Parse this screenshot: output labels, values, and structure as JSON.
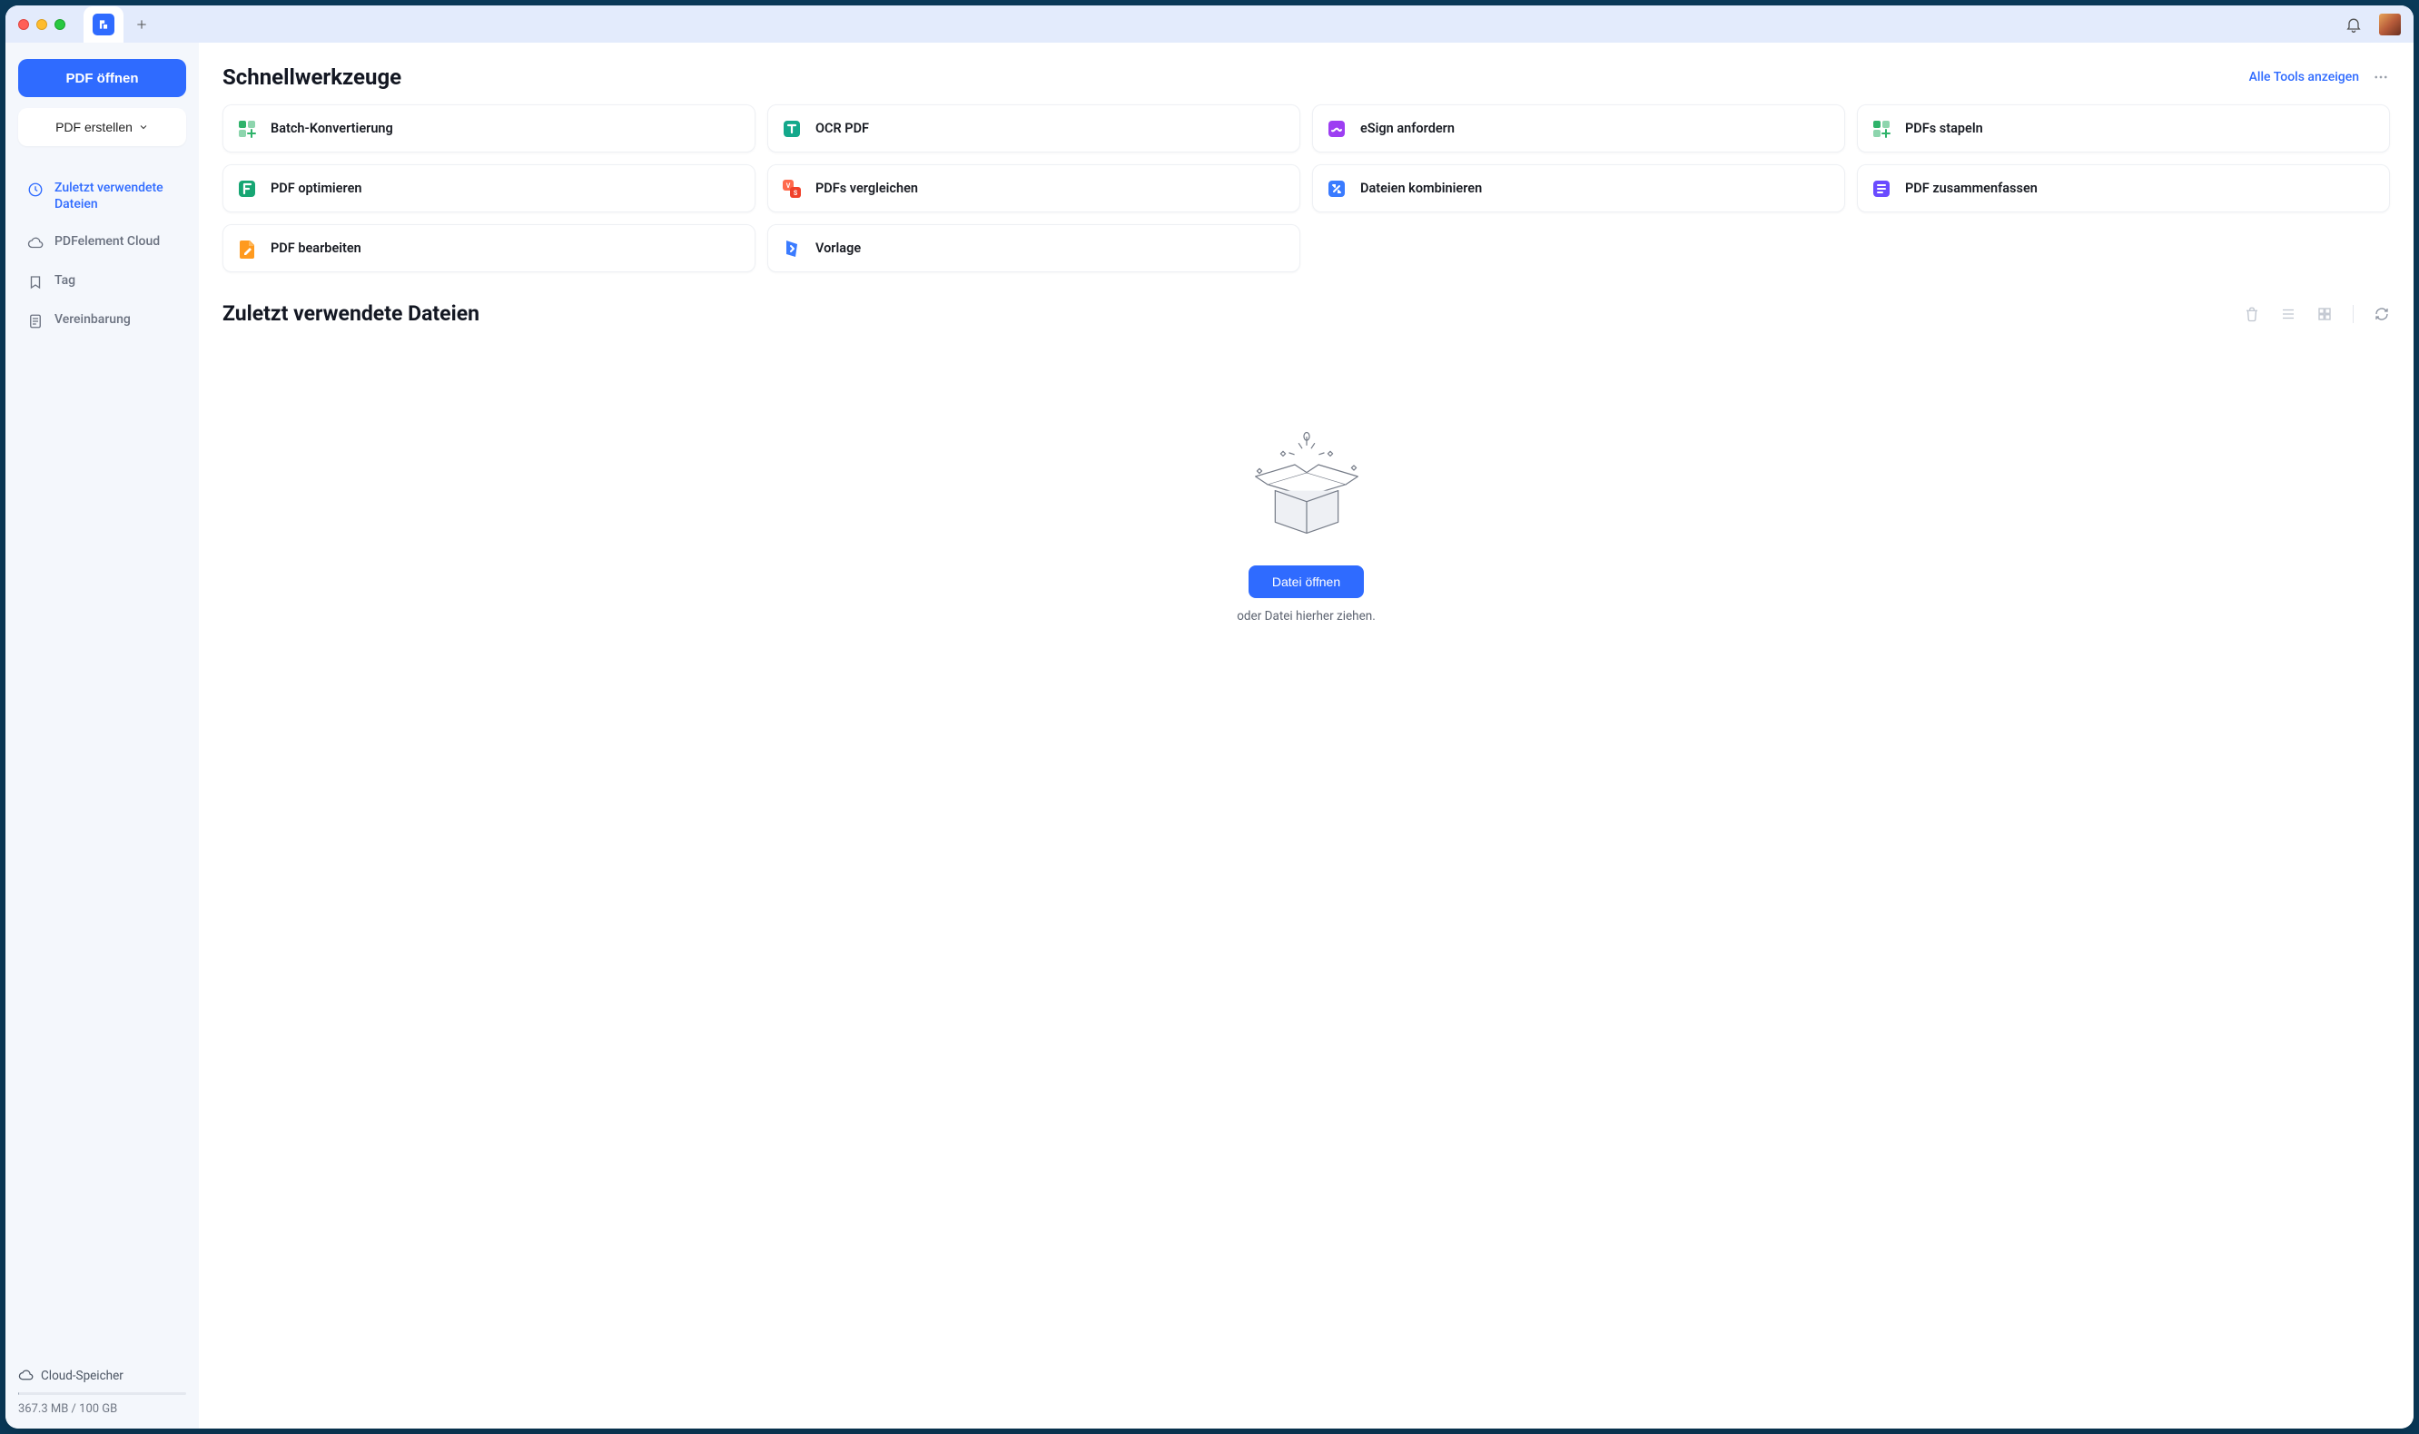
{
  "sidebar": {
    "open_pdf": "PDF öffnen",
    "create_pdf": "PDF erstellen",
    "nav": [
      {
        "id": "recent",
        "label": "Zuletzt verwendete Dateien",
        "active": true
      },
      {
        "id": "cloud",
        "label": "PDFelement Cloud",
        "active": false
      },
      {
        "id": "tag",
        "label": "Tag",
        "active": false
      },
      {
        "id": "agreement",
        "label": "Vereinbarung",
        "active": false
      }
    ],
    "storage_label": "Cloud-Speicher",
    "storage_text": "367.3 MB / 100 GB"
  },
  "quicktools": {
    "title": "Schnellwerkzeuge",
    "show_all": "Alle Tools anzeigen",
    "tools": [
      {
        "id": "batch-convert",
        "label": "Batch-Konvertierung",
        "color": "#2fb36a",
        "shape": "squares"
      },
      {
        "id": "ocr-pdf",
        "label": "OCR PDF",
        "color": "#14a88b",
        "shape": "t-block"
      },
      {
        "id": "esign",
        "label": "eSign anfordern",
        "color": "#9d3ef2",
        "shape": "sign"
      },
      {
        "id": "stack",
        "label": "PDFs stapeln",
        "color": "#2fb36a",
        "shape": "squares"
      },
      {
        "id": "optimize",
        "label": "PDF optimieren",
        "color": "#17a673",
        "shape": "f-block"
      },
      {
        "id": "compare",
        "label": "PDFs vergleichen",
        "color": "#f05a3f",
        "shape": "vs"
      },
      {
        "id": "combine",
        "label": "Dateien kombinieren",
        "color": "#3a7bff",
        "shape": "combine"
      },
      {
        "id": "summarize",
        "label": "PDF zusammenfassen",
        "color": "#6a4bff",
        "shape": "sum"
      },
      {
        "id": "edit",
        "label": "PDF bearbeiten",
        "color": "#ff9a1f",
        "shape": "edit"
      },
      {
        "id": "template",
        "label": "Vorlage",
        "color": "#3a7bff",
        "shape": "tpl"
      }
    ]
  },
  "recent": {
    "title": "Zuletzt verwendete Dateien",
    "open_file": "Datei öffnen",
    "drag_hint": "oder Datei hierher ziehen."
  }
}
